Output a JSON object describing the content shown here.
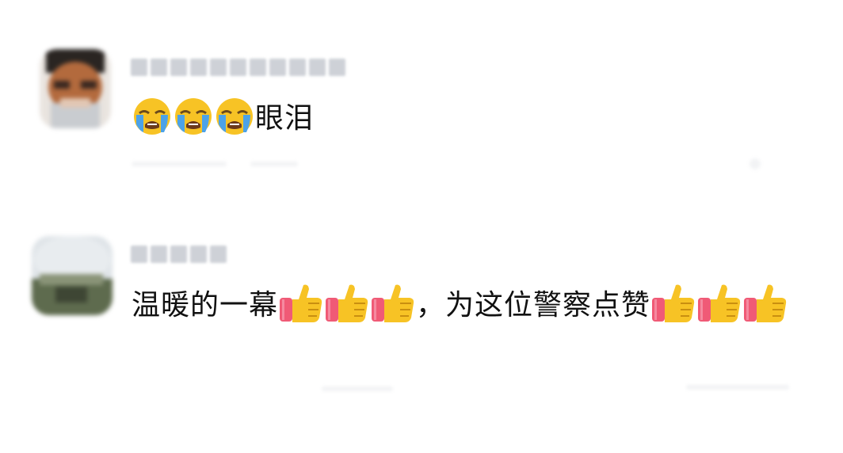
{
  "comments": [
    {
      "text_after_emoji": "眼泪",
      "emojis_before": [
        "loudly-crying-face",
        "loudly-crying-face",
        "loudly-crying-face"
      ]
    },
    {
      "text_part1": "温暖的一幕",
      "emojis_mid": [
        "thumbs-up",
        "thumbs-up",
        "thumbs-up"
      ],
      "text_part2": "，为这位警察点赞",
      "emojis_end": [
        "thumbs-up",
        "thumbs-up",
        "thumbs-up"
      ]
    }
  ],
  "colors": {
    "text": "#111111",
    "emoji_yellow": "#F7C325",
    "tear_blue": "#4CA2E8",
    "sleeve_pink": "#F05A76"
  }
}
